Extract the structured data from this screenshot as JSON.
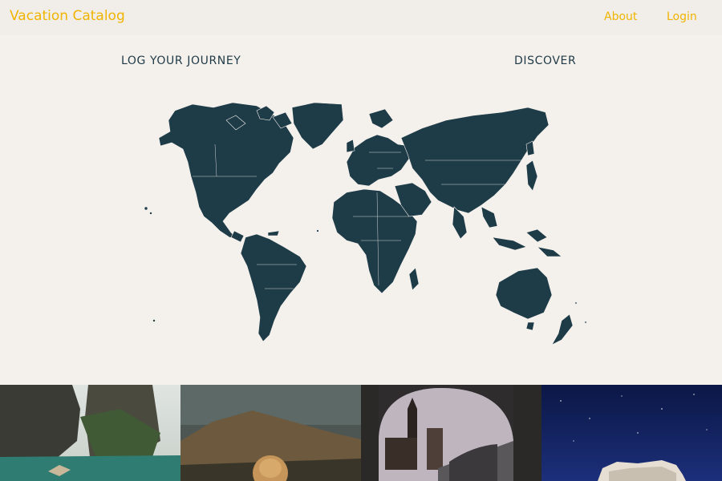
{
  "header": {
    "brand": "Vacation Catalog",
    "nav": [
      {
        "label": "About"
      },
      {
        "label": "Login"
      }
    ]
  },
  "hero": {
    "left_label": "LOG YOUR JOURNEY",
    "right_label": "DISCOVER"
  },
  "colors": {
    "accent": "#f0b400",
    "map": "#1e3b48",
    "background": "#f4f1ed"
  },
  "gallery": [
    {
      "subject": "lagoon-cliffs-photo"
    },
    {
      "subject": "traveler-hair-photo"
    },
    {
      "subject": "london-bridge-photo"
    },
    {
      "subject": "night-sky-rock-photo"
    }
  ]
}
